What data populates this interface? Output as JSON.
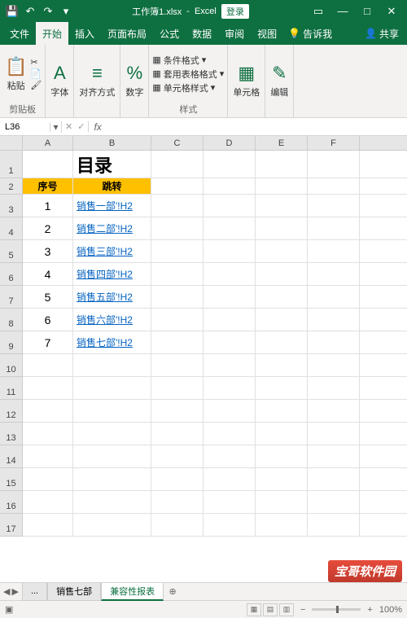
{
  "titlebar": {
    "filename": "工作簿1.xlsx",
    "app": "Excel",
    "login": "登录"
  },
  "tabs": {
    "file": "文件",
    "home": "开始",
    "insert": "插入",
    "layout": "页面布局",
    "formulas": "公式",
    "data": "数据",
    "review": "审阅",
    "view": "视图",
    "tellme": "告诉我",
    "share": "共享"
  },
  "ribbon": {
    "paste": "粘贴",
    "clipboard": "剪贴板",
    "font": "字体",
    "alignment": "对齐方式",
    "number": "数字",
    "styles": "样式",
    "cond_format": "条件格式",
    "table_format": "套用表格格式",
    "cell_style": "单元格样式",
    "cells": "单元格",
    "editing": "编辑"
  },
  "formula": {
    "namebox": "L36",
    "fx": "fx"
  },
  "cols": [
    "A",
    "B",
    "C",
    "D",
    "E",
    "F"
  ],
  "sheet": {
    "title": "目录",
    "header_seq": "序号",
    "header_jump": "跳转",
    "rows": [
      {
        "seq": "1",
        "link": "销售一部'!H2"
      },
      {
        "seq": "2",
        "link": "销售二部'!H2"
      },
      {
        "seq": "3",
        "link": "销售三部'!H2"
      },
      {
        "seq": "4",
        "link": "销售四部'!H2"
      },
      {
        "seq": "5",
        "link": "销售五部'!H2"
      },
      {
        "seq": "6",
        "link": "销售六部'!H2"
      },
      {
        "seq": "7",
        "link": "销售七部'!H2"
      }
    ]
  },
  "sheettabs": {
    "ellipsis": "...",
    "tab1": "销售七部",
    "tab2": "兼容性报表"
  },
  "status": {
    "zoom": "100%"
  },
  "watermark": "宝哥软件园"
}
